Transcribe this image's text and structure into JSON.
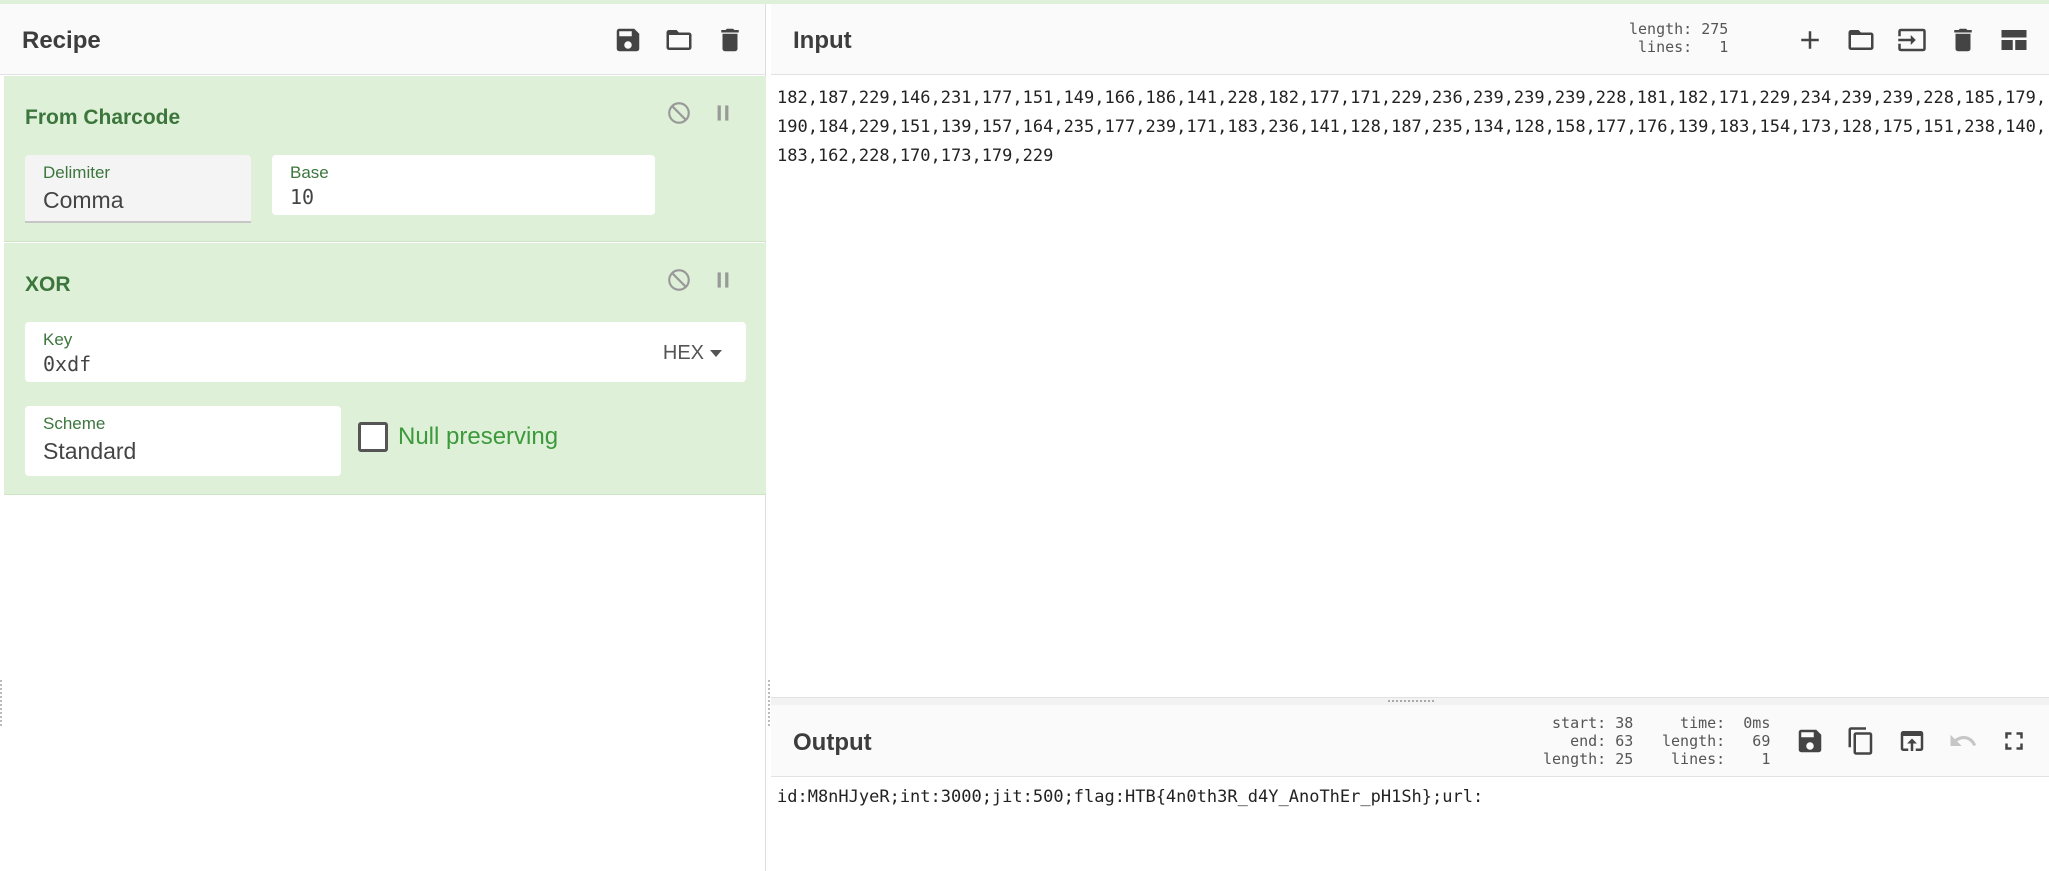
{
  "recipe": {
    "title": "Recipe",
    "operations": [
      {
        "name": "From Charcode",
        "fields": [
          {
            "label": "Delimiter",
            "value": "Comma"
          },
          {
            "label": "Base",
            "value": "10"
          }
        ]
      },
      {
        "name": "XOR",
        "key": {
          "label": "Key",
          "value": "0xdf",
          "format": "HEX"
        },
        "scheme": {
          "label": "Scheme",
          "value": "Standard"
        },
        "null_preserving": {
          "label": "Null preserving",
          "checked": false
        }
      }
    ]
  },
  "input": {
    "title": "Input",
    "stats": "length: 275\n lines:   1",
    "text": "182,187,229,146,231,177,151,149,166,186,141,228,182,177,171,229,236,239,239,239,228,181,182,171,229,234,239,239,228,185,179,190,184,229,151,139,157,164,235,177,239,171,183,236,141,128,187,235,134,128,158,177,176,139,183,154,173,128,175,151,238,140,183,162,228,170,173,179,229"
  },
  "output": {
    "title": "Output",
    "stats_left": " start: 38\n   end: 63\nlength: 25",
    "stats_right": "  time:  0ms\nlength:   69\n lines:    1",
    "text": "id:M8nHJyeR;int:3000;jit:500;flag:HTB{4n0th3R_d4Y_AnoThEr_pH1Sh};url:"
  },
  "icons": {
    "recipe": [
      "save-icon",
      "folder-icon",
      "trash-icon"
    ],
    "input": [
      "plus-icon",
      "folder-icon",
      "input-arrow-icon",
      "trash-icon",
      "layout-icon"
    ],
    "output": [
      "save-icon",
      "copy-icon",
      "open-external-icon",
      "undo-icon",
      "fullscreen-icon"
    ]
  },
  "colors": {
    "operation_bg": "#dff0d8",
    "operation_text": "#3c763d",
    "checkbox_label": "#3c9a3c"
  }
}
